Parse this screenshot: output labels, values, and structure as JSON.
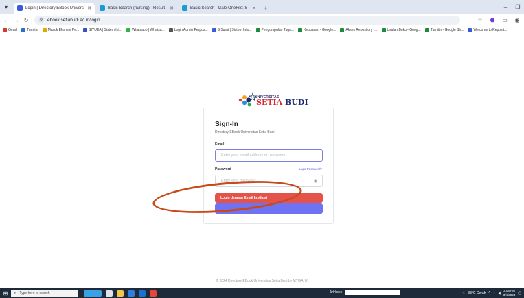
{
  "browser": {
    "tabs": [
      {
        "label": "Login | Directory EBook Univers",
        "active": true,
        "fav_color": "#3a5bd9"
      },
      {
        "label": "Basic Search (nursing) - Result",
        "active": false,
        "fav_color": "#1d9bd1"
      },
      {
        "label": "Basic Search - Gale OneFile: S",
        "active": false,
        "fav_color": "#1d9bd1"
      }
    ],
    "url": "ebook.setiabudi.ac.id/login",
    "bookmarks": [
      {
        "label": "Gmail",
        "color": "#d33b2c"
      },
      {
        "label": "Turnitin",
        "color": "#2b6fd6"
      },
      {
        "label": "Masuk Ekonesi Pe...",
        "color": "#e0a800"
      },
      {
        "label": "SIYUDA | Sistem Inf...",
        "color": "#3b4fc4"
      },
      {
        "label": "Whatsapp | Whatsa...",
        "color": "#2cb742"
      },
      {
        "label": "Login Admin Perpus...",
        "color": "#555555"
      },
      {
        "label": "SISurat | Sistem Info...",
        "color": "#3a5bd9"
      },
      {
        "label": "Pengumpulan Tuga...",
        "color": "#1d8c3a"
      },
      {
        "label": "Kepuasan - Google...",
        "color": "#1d8c3a"
      },
      {
        "label": "Akses Repository -...",
        "color": "#1d8c3a"
      },
      {
        "label": "Usulan Buku - Goog...",
        "color": "#1d8c3a"
      },
      {
        "label": "Turnitin - Google Sh...",
        "color": "#1d8c3a"
      },
      {
        "label": "Welcome to Reposit...",
        "color": "#3a5bd9"
      }
    ]
  },
  "logo": {
    "small": "UNIVERSITAS",
    "name_part1": "SETIA",
    "name_part2": "BUDI"
  },
  "login": {
    "title": "Sign-In",
    "subtitle": "Directory EBook Universitas Setia Budi",
    "email_label": "Email",
    "email_placeholder": "Enter your email address or username",
    "password_label": "Password",
    "forgot_label": "Lupa Password?",
    "password_placeholder": "Enter your password",
    "institution_button": "Login dengan Email Institusi"
  },
  "footer": "© 2024 Directory EBook Universitas Setia Budi by MTWAHY",
  "taskbar": {
    "search_placeholder": "Type here to search",
    "address_label": "Address",
    "weather": "33°C Cerah",
    "time": "3:08 PM",
    "date": "3/4/2024"
  }
}
